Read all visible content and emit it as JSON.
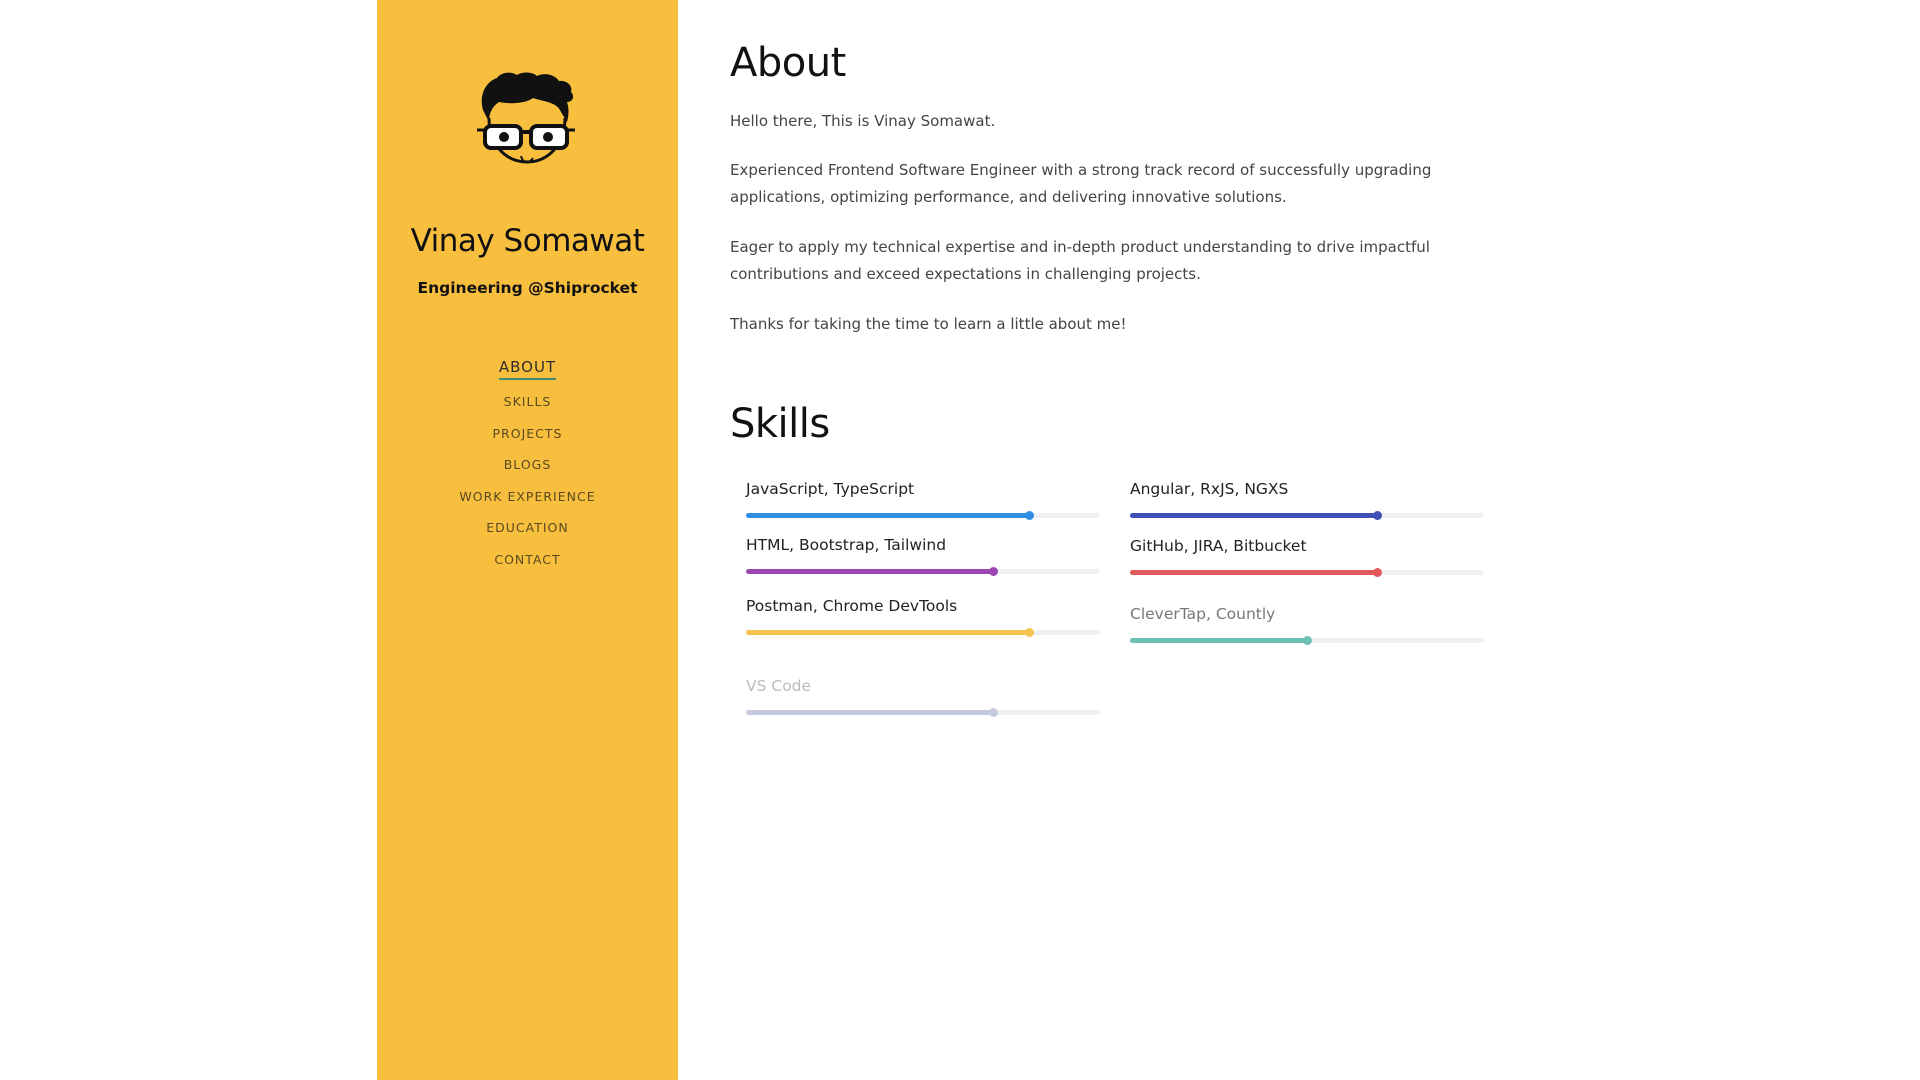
{
  "profile": {
    "name": "Vinay Somawat",
    "role": "Engineering @Shiprocket"
  },
  "nav": [
    {
      "label": "ABOUT",
      "active": true
    },
    {
      "label": "SKILLS"
    },
    {
      "label": "PROJECTS"
    },
    {
      "label": "BLOGS"
    },
    {
      "label": "WORK EXPERIENCE"
    },
    {
      "label": "EDUCATION"
    },
    {
      "label": "CONTACT"
    }
  ],
  "about": {
    "title": "About",
    "paragraphs": [
      "Hello there, This is Vinay Somawat.",
      "Experienced Frontend Software Engineer with a strong track record of successfully upgrading applications, optimizing performance, and delivering innovative solutions.",
      "Eager to apply my technical expertise and in-depth product understanding to drive impactful contributions and exceed expectations in challenging projects.",
      "Thanks for taking the time to learn a little about me!"
    ]
  },
  "skills": {
    "title": "Skills",
    "items": [
      {
        "label": "JavaScript, TypeScript",
        "level": 0.8,
        "color": "#2f8fe5",
        "label_color": "#222222"
      },
      {
        "label": "Angular, RxJS, NGXS",
        "level": 0.7,
        "color": "#3f51b5",
        "label_color": "#222222"
      },
      {
        "label": "HTML, Bootstrap, Tailwind",
        "level": 0.7,
        "color": "#9c46b3",
        "label_color": "#222222"
      },
      {
        "label": "GitHub, JIRA, Bitbucket",
        "level": 0.7,
        "color": "#e3585b",
        "label_color": "#222222"
      },
      {
        "label": "Postman, Chrome DevTools",
        "level": 0.8,
        "color": "#f6c44e",
        "label_color": "#222222"
      },
      {
        "label": "CleverTap, Countly",
        "level": 0.5,
        "color": "#6cbfb2",
        "label_color": "#777777"
      },
      {
        "label": "VS Code",
        "level": 0.7,
        "color": "#c5cadf",
        "label_color": "#bbbbbb"
      }
    ]
  },
  "colors": {
    "sidebar": "#f8bf3e",
    "nav_underline": "#3f8a78"
  }
}
